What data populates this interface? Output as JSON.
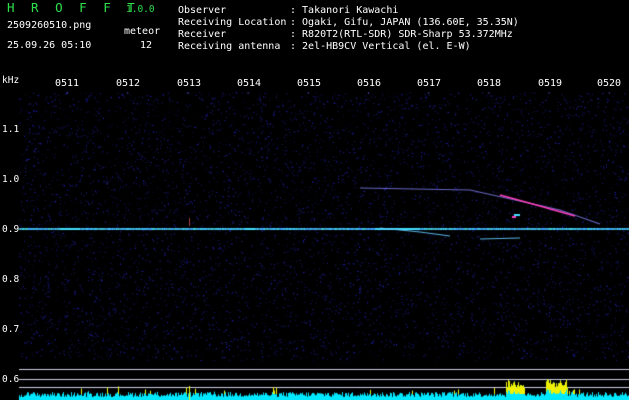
{
  "header": {
    "app_title": "H R O F F T",
    "version": "1.0.0",
    "filename": "2509260510.png",
    "datetime": "25.09.26 05:10",
    "meteor_label": "meteor",
    "meteor_count": "12"
  },
  "station": {
    "observer_label": "Observer",
    "observer_value": ": Takanori Kawachi",
    "location_label": "Receiving Location",
    "location_value": ": Ogaki, Gifu, JAPAN (136.60E, 35.35N)",
    "receiver_label": "Receiver",
    "receiver_value": ": R820T2(RTL-SDR) SDR-Sharp 53.372MHz",
    "antenna_label": "Receiving antenna",
    "antenna_value": ": 2el-HB9CV Vertical (el. E-W)"
  },
  "axis": {
    "freq_unit": "kHz",
    "time_ticks": [
      "0511",
      "0512",
      "0513",
      "0514",
      "0515",
      "0516",
      "0517",
      "0518",
      "0519",
      "0520"
    ],
    "freq_ticks": [
      "1.1",
      "1.0",
      "0.9",
      "0.8",
      "0.7",
      "0.6"
    ]
  },
  "colors": {
    "background": "#000000",
    "title_green": "#2ee04a",
    "noise_blue": "#1a1aa0",
    "carrier_cyan": "#40e0ff",
    "level_cyan": "#00e8ff",
    "level_yellow": "#f0f000",
    "echo_magenta": "#ff40c0"
  }
}
